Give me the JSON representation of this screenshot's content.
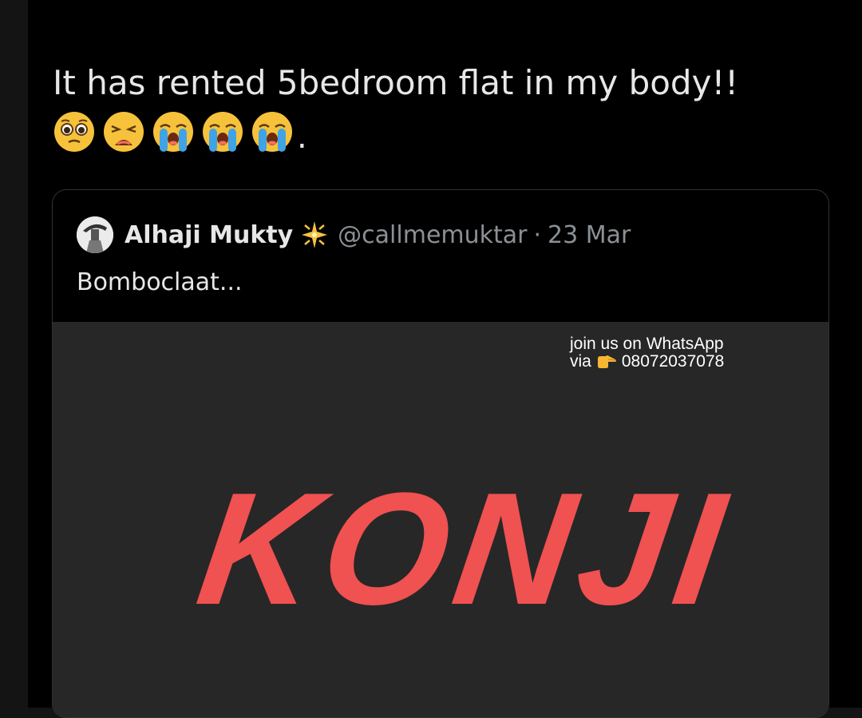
{
  "tweet": {
    "text": "It has rented 5bedroom flat in my body!!",
    "emojis": [
      "pleading-face-icon",
      "weary-face-icon",
      "loudly-crying-face-icon",
      "loudly-crying-face-icon",
      "loudly-crying-face-icon"
    ],
    "trailing_punct": "."
  },
  "quote": {
    "author_name": "Alhaji Mukty",
    "author_badge_icon": "sparkle-icon",
    "handle": "@callmemuktar",
    "separator": "·",
    "date": "23 Mar",
    "text": "Bomboclaat...",
    "media": {
      "watermark_line1": "join us on WhatsApp",
      "watermark_via": "via",
      "watermark_number": "08072037078",
      "big_text": "KONJI",
      "big_text_color": "#f05151",
      "background_color": "#272727"
    }
  }
}
